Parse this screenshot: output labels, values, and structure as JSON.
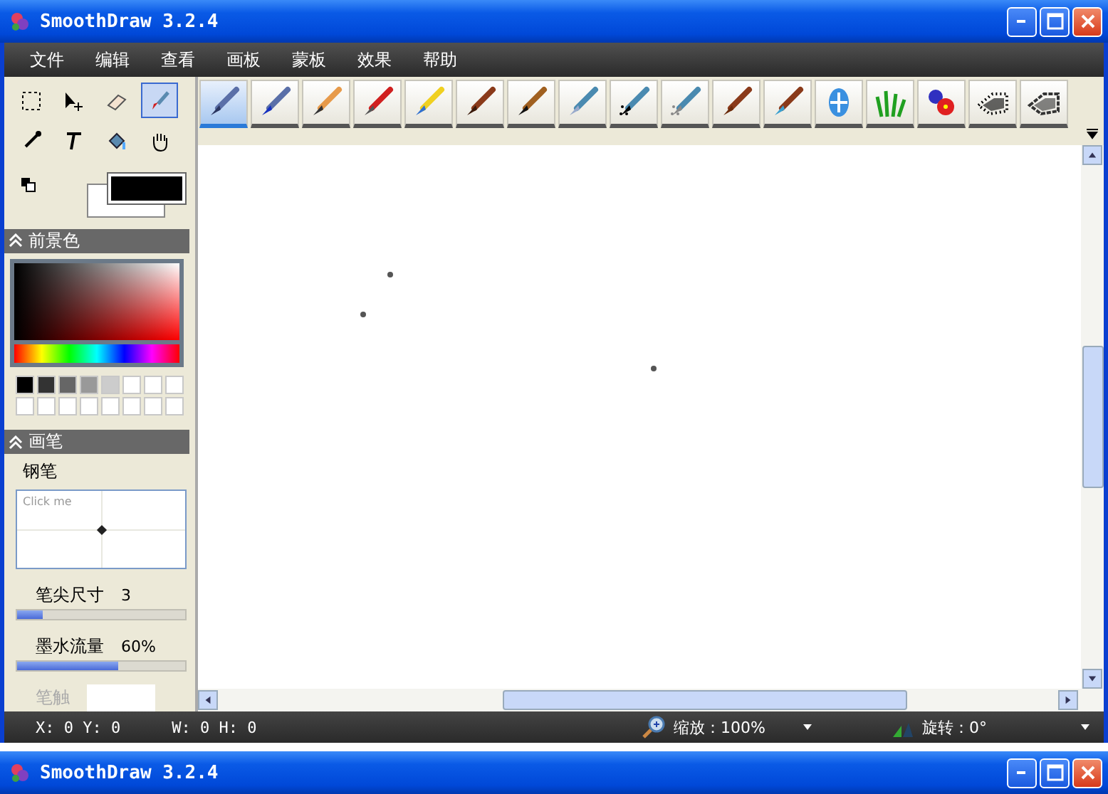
{
  "window": {
    "title": "SmoothDraw 3.2.4"
  },
  "menu": [
    "文件",
    "编辑",
    "查看",
    "画板",
    "蒙板",
    "效果",
    "帮助"
  ],
  "tools": [
    {
      "kind": "select",
      "selected": false
    },
    {
      "kind": "move",
      "selected": false
    },
    {
      "kind": "eraser",
      "selected": false
    },
    {
      "kind": "brush",
      "selected": true
    },
    {
      "kind": "picker",
      "selected": false
    },
    {
      "kind": "text",
      "selected": false
    },
    {
      "kind": "fill",
      "selected": false
    },
    {
      "kind": "hand",
      "selected": false
    }
  ],
  "color_panel": {
    "title": "前景色",
    "swatches": [
      {
        "color": "#000000"
      },
      {
        "color": "#333333"
      },
      {
        "color": "#666666"
      },
      {
        "color": "#999999"
      },
      {
        "color": "#cccccc"
      },
      {
        "color": "#ffffff"
      },
      {
        "color": "#ffffff"
      },
      {
        "color": "#ffffff"
      },
      {
        "color": "#ffffff"
      },
      {
        "color": "#ffffff"
      },
      {
        "color": "#ffffff"
      },
      {
        "color": "#ffffff"
      },
      {
        "color": "#ffffff"
      },
      {
        "color": "#ffffff"
      },
      {
        "color": "#ffffff"
      },
      {
        "color": "#ffffff"
      }
    ]
  },
  "brush_panel": {
    "title": "画笔",
    "brush_name": "钢笔",
    "preview_hint": "Click me",
    "settings": [
      {
        "kind": "slider",
        "label": "笔尖尺寸",
        "reading": "3",
        "level": 0.15,
        "disabled": false
      },
      {
        "kind": "slider",
        "label": "墨水流量",
        "reading": "60%",
        "level": 0.6,
        "disabled": false
      },
      {
        "kind": "texture",
        "label": "笔触",
        "disabled": true
      }
    ]
  },
  "brushes": [
    {
      "kind": "pen",
      "selected": true
    },
    {
      "kind": "ink-pen",
      "selected": false
    },
    {
      "kind": "pencil",
      "selected": false
    },
    {
      "kind": "red-pencil",
      "selected": false
    },
    {
      "kind": "marker",
      "selected": false
    },
    {
      "kind": "brush",
      "selected": false
    },
    {
      "kind": "dark-brush",
      "selected": false
    },
    {
      "kind": "airbrush",
      "selected": false
    },
    {
      "kind": "spray",
      "selected": false
    },
    {
      "kind": "fan-spray",
      "selected": false
    },
    {
      "kind": "flat-brush",
      "selected": false
    },
    {
      "kind": "water-brush",
      "selected": false
    },
    {
      "kind": "glow",
      "selected": false
    },
    {
      "kind": "grass",
      "selected": false
    },
    {
      "kind": "flowers",
      "selected": false
    },
    {
      "kind": "dots",
      "selected": false
    },
    {
      "kind": "checker",
      "selected": false
    }
  ],
  "status_bar": {
    "position": "X: 0 Y: 0",
    "size": "W: 0 H: 0",
    "zoom": "缩放：100%",
    "rotation": "旋转：0°"
  },
  "second_window": {
    "title": "SmoothDraw 3.2.4"
  }
}
